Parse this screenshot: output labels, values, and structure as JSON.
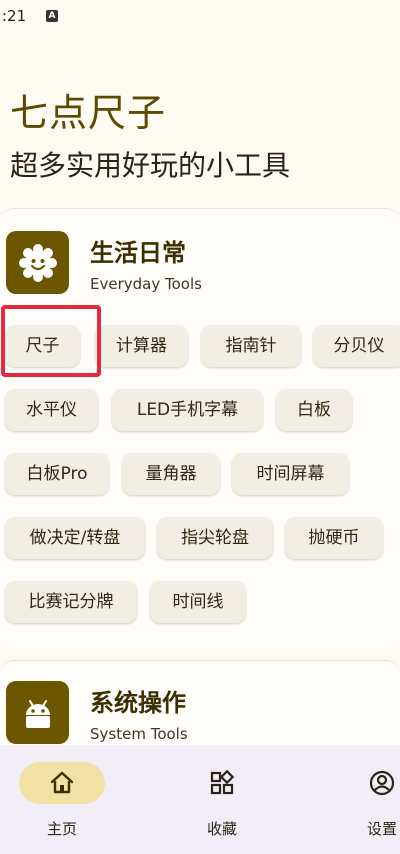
{
  "status_bar": {
    "time": ":21",
    "notification_badge": "A"
  },
  "header": {
    "title": "七点尺子",
    "subtitle": "超多实用好玩的小工具"
  },
  "categories": [
    {
      "title": "生活日常",
      "subtitle": "Everyday Tools",
      "icon": "sun-face-icon",
      "tools": [
        "尺子",
        "计算器",
        "指南针",
        "分贝仪",
        "水平仪",
        "LED手机字幕",
        "白板",
        "白板Pro",
        "量角器",
        "时间屏幕",
        "做决定/转盘",
        "指尖轮盘",
        "抛硬币",
        "比赛记分牌",
        "时间线"
      ]
    },
    {
      "title": "系统操作",
      "subtitle": "System Tools",
      "icon": "android-icon"
    }
  ],
  "bottom_nav": [
    {
      "label": "主页",
      "icon": "home-icon",
      "selected": true
    },
    {
      "label": "收藏",
      "icon": "apps-icon",
      "selected": false
    },
    {
      "label": "设置",
      "icon": "account-icon",
      "selected": false
    }
  ],
  "colors": {
    "accent": "#6c5600",
    "highlight": "#e32a3e",
    "chip_bg": "#f2eee3",
    "nav_pill": "#f1e1a5"
  }
}
